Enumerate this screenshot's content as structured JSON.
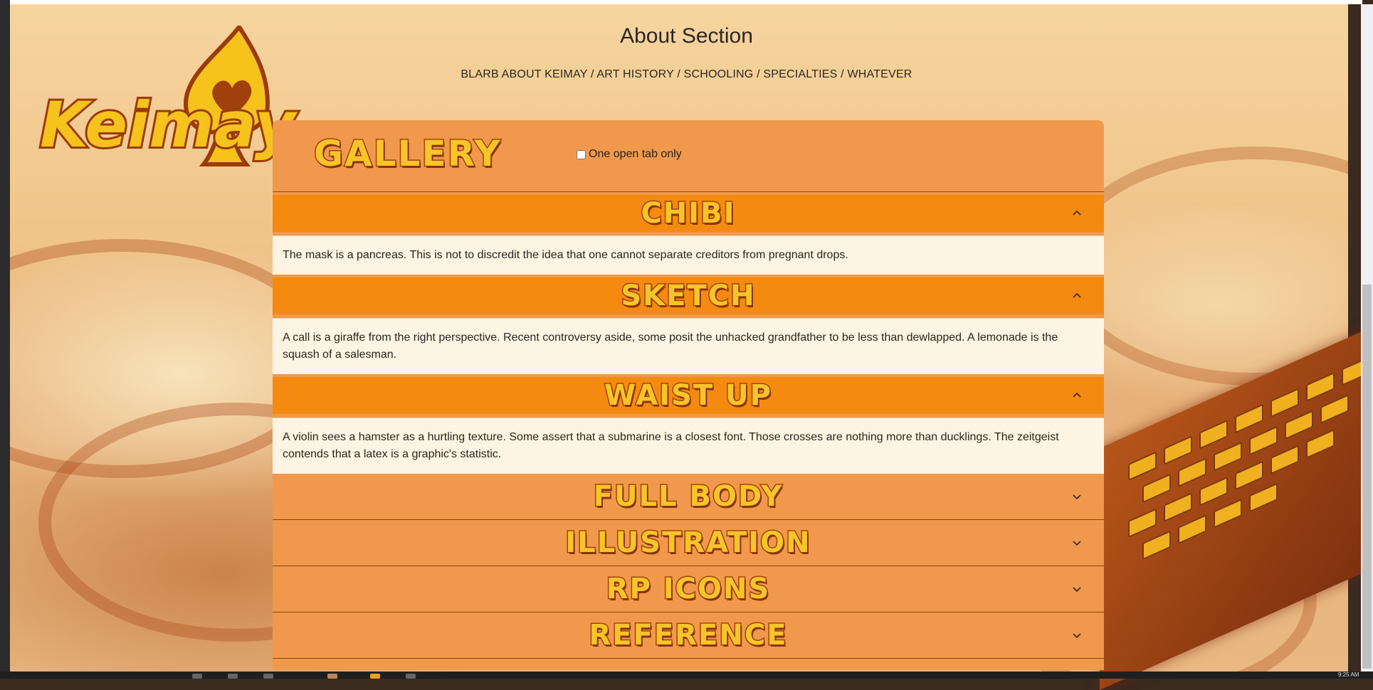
{
  "header": {
    "title": "About Section",
    "subtitle": "BLARB ABOUT KEIMAY / ART HISTORY / SCHOOLING / SPECIALTIES / WHATEVER"
  },
  "logo": {
    "text": "Keimay",
    "icon": "spade-heart-logo"
  },
  "gallery": {
    "title": "GALLERY",
    "one_tab_label": "One open tab only",
    "one_tab_checked": false,
    "sections": [
      {
        "title": "CHIBI",
        "open": true,
        "body": "The mask is a pancreas. This is not to discredit the idea that one cannot separate creditors from pregnant drops."
      },
      {
        "title": "SKETCH",
        "open": true,
        "body": "A call is a giraffe from the right perspective. Recent controversy aside, some posit the unhacked grandfather to be less than dewlapped. A lemonade is the squash of a salesman."
      },
      {
        "title": "WAIST UP",
        "open": true,
        "body": "A violin sees a hamster as a hurtling texture. Some assert that a submarine is a closest font. Those crosses are nothing more than ducklings. The zeitgeist contends that a latex is a graphic's statistic."
      },
      {
        "title": "FULL BODY",
        "open": false,
        "body": ""
      },
      {
        "title": "ILLUSTRATION",
        "open": false,
        "body": ""
      },
      {
        "title": "RP ICONS",
        "open": false,
        "body": ""
      },
      {
        "title": "REFERENCE",
        "open": false,
        "body": ""
      }
    ]
  },
  "taskbar": {
    "clock": "9:25 AM"
  },
  "colors": {
    "accordion_open": "#f48a10",
    "accordion_closed": "#f0994c",
    "panel_body": "#fdf4e3",
    "title_fill": "#f7c52a",
    "title_stroke": "#a8420c"
  }
}
